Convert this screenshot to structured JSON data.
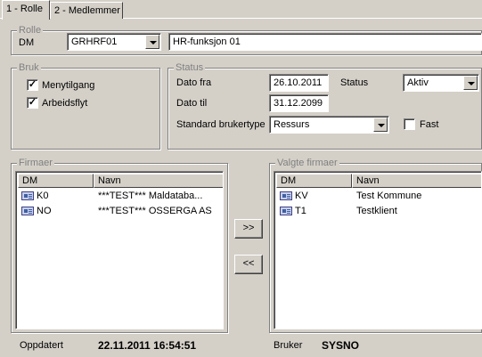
{
  "tabs": [
    {
      "label": "1 - Rolle",
      "active": true
    },
    {
      "label": "2 - Medlemmer",
      "active": false
    }
  ],
  "rolle": {
    "title": "Rolle",
    "dm_label": "DM",
    "dm_value": "GRHRF01",
    "name_value": "HR-funksjon 01"
  },
  "bruk": {
    "title": "Bruk",
    "items": [
      {
        "label": "Menytilgang",
        "checked": true
      },
      {
        "label": "Arbeidsflyt",
        "checked": true
      }
    ]
  },
  "status": {
    "title": "Status",
    "dato_fra_label": "Dato fra",
    "dato_fra_value": "26.10.2011",
    "dato_til_label": "Dato til",
    "dato_til_value": "31.12.2099",
    "status_label": "Status",
    "status_value": "Aktiv",
    "brukertype_label": "Standard brukertype",
    "brukertype_value": "Ressurs",
    "fast_label": "Fast",
    "fast_checked": false
  },
  "firmaer": {
    "title": "Firmaer",
    "columns": [
      "DM",
      "Navn"
    ],
    "rows": [
      {
        "dm": "K0",
        "navn": "***TEST*** Maldataba..."
      },
      {
        "dm": "NO",
        "navn": "***TEST*** OSSERGA AS"
      }
    ]
  },
  "valgte_firmaer": {
    "title": "Valgte firmaer",
    "columns": [
      "DM",
      "Navn"
    ],
    "rows": [
      {
        "dm": "KV",
        "navn": "Test Kommune"
      },
      {
        "dm": "T1",
        "navn": "Testklient"
      }
    ]
  },
  "buttons": {
    "add_all": ">>",
    "remove_all": "<<"
  },
  "footer": {
    "oppdatert_label": "Oppdatert",
    "oppdatert_value": "22.11.2011 16:54:51",
    "bruker_label": "Bruker",
    "bruker_value": "SYSNO"
  }
}
